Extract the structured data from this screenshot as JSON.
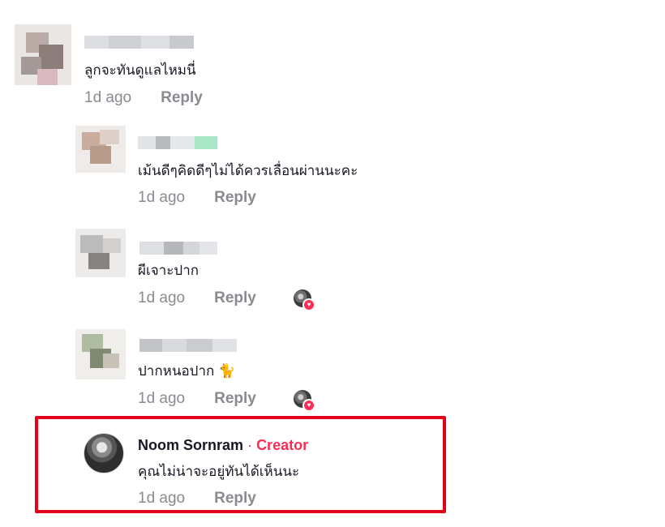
{
  "comments": [
    {
      "text": "ลูกจะทันดูแลไหมนี่",
      "time": "1d ago",
      "reply": "Reply"
    },
    {
      "text": "เม้นดีๆคิดดีๆไม่ได้ควรเลื่อนผ่านนะคะ",
      "time": "1d ago",
      "reply": "Reply"
    },
    {
      "text": "ผีเจาะปาก",
      "time": "1d ago",
      "reply": "Reply"
    },
    {
      "text": "ปากหนอปาก 🐈",
      "time": "1d ago",
      "reply": "Reply"
    }
  ],
  "creator_comment": {
    "name": "Noom Sornram",
    "separator": "·",
    "badge": "Creator",
    "text": "คุณไม่น่าจะอยู่ทันได้เห็นนะ",
    "time": "1d ago",
    "reply": "Reply"
  },
  "colors": {
    "accent": "#fe2c55",
    "highlight_border": "#e3001b",
    "meta_text": "#8a8b91"
  },
  "icons": {
    "liked_by_creator": "creator-liked-avatar-icon",
    "heart": "heart-icon"
  }
}
